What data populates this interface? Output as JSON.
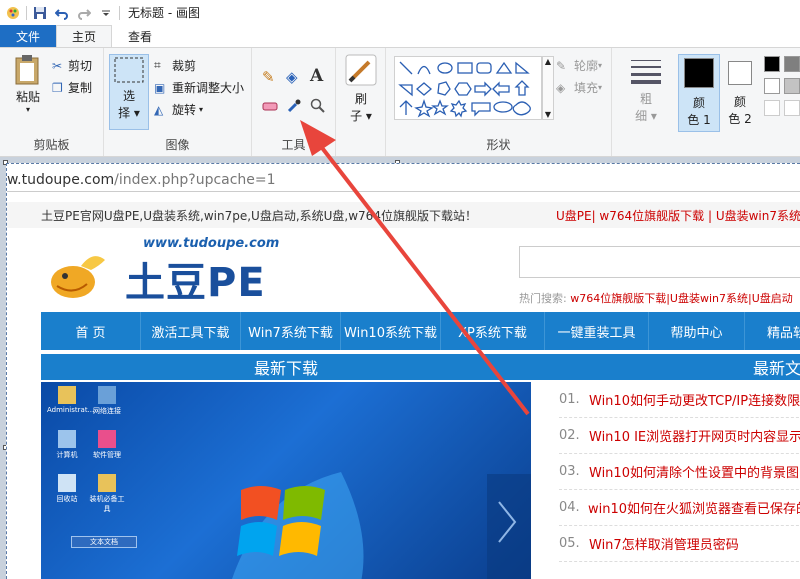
{
  "titlebar": {
    "title": "无标题 - 画图"
  },
  "tabs": {
    "file": "文件",
    "home": "主页",
    "view": "查看"
  },
  "ribbon": {
    "clipboard": {
      "paste": "粘贴",
      "cut": "剪切",
      "copy": "复制",
      "group": "剪贴板"
    },
    "image": {
      "select_line1": "选",
      "select_line2": "择",
      "crop": "裁剪",
      "resize": "重新调整大小",
      "rotate": "旋转",
      "group": "图像"
    },
    "tools": {
      "group": "工具"
    },
    "brush": {
      "line1": "刷",
      "line2": "子"
    },
    "shapes": {
      "outline": "轮廓",
      "fill": "填充",
      "group": "形状"
    },
    "size": {
      "line1": "粗",
      "line2": "细"
    },
    "color1": {
      "line1": "颜",
      "line2": "色 1"
    },
    "color2": {
      "line1": "颜",
      "line2": "色 2"
    }
  },
  "page": {
    "url_host": "w.tudoupe.com",
    "url_path": "/index.php?upcache=1",
    "top_left": "土豆PE官网U盘PE,U盘装系统,win7pe,U盘启动,系统U盘,w764位旗舰版下载站！",
    "top_right": "U盘PE| w764位旗舰版下载 | U盘装win7系统",
    "logo_url": "www.tudoupe.com",
    "logo_text": "土豆PE",
    "hot_label": "热门搜索:",
    "hot_links": "w764位旗舰版下载|U盘装win7系统|U盘启动",
    "nav": [
      "首 页",
      "激活工具下载",
      "Win7系统下载",
      "Win10系统下载",
      "XP系统下载",
      "一键重装工具",
      "帮助中心",
      "精品软"
    ],
    "sec_left": "最新下载",
    "sec_right": "最新文",
    "articles": [
      {
        "num": "01.",
        "title": "Win10如何手动更改TCP/IP连接数限"
      },
      {
        "num": "02.",
        "title": "Win10 IE浏览器打开网页时内容显示"
      },
      {
        "num": "03.",
        "title": "Win10如何清除个性设置中的背景图"
      },
      {
        "num": "04.",
        "title": "win10如何在火狐浏览器查看已保存的"
      },
      {
        "num": "05.",
        "title": "Win7怎样取消管理员密码"
      }
    ],
    "desktop_icons": [
      "Administrat...",
      "网络连接",
      "计算机",
      "软件管理",
      "回收站",
      "装机必备工具",
      "文本文档"
    ]
  },
  "colors": {
    "accent": "#1e6ec4",
    "nav_blue": "#1a7fcc",
    "arrow": "#e8453c",
    "link_red": "#cc0000"
  }
}
